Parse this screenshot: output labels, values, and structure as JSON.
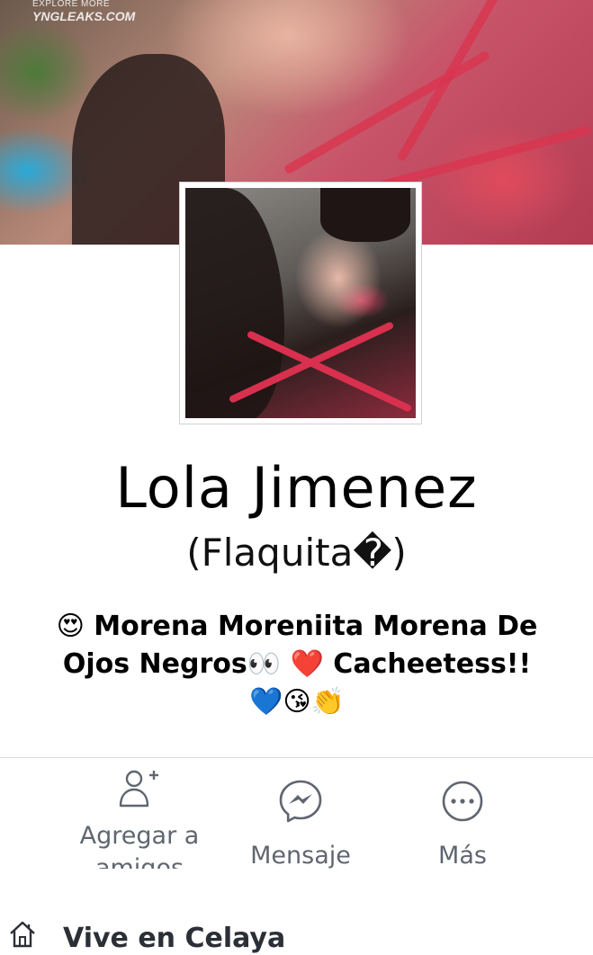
{
  "cover": {
    "watermark_top": "EXPLORE MORE",
    "watermark_brand": "YNGLEAKS.COM"
  },
  "profile": {
    "name": "Lola Jimenez",
    "nickname": "(Flaquita�)",
    "bio": "😍 Morena Moreniita Morena De Ojos Negros👀 ❤️ Cacheetess!!💙😘👏"
  },
  "actions": {
    "add_friend_label": "Agregar a amigos",
    "message_label": "Mensaje",
    "more_label": "Más"
  },
  "info": {
    "lives_in": "Vive en Celaya"
  },
  "colors": {
    "icon_gray": "#5f6670",
    "divider": "#d8dbe0"
  }
}
